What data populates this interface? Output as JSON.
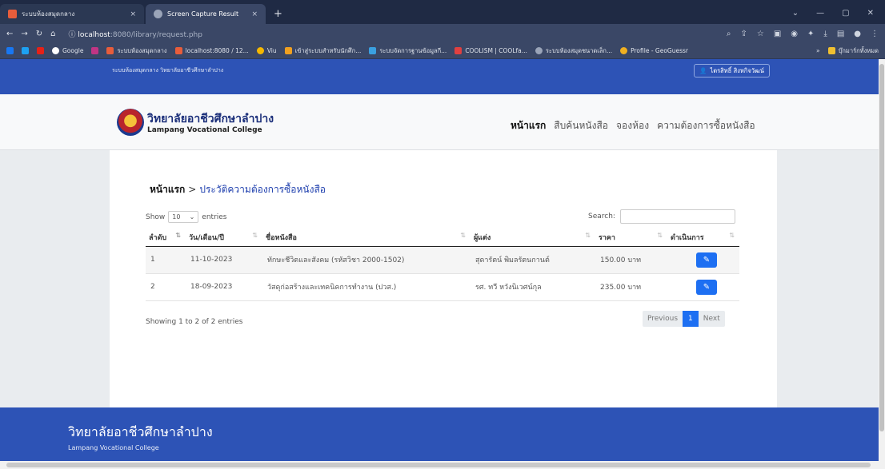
{
  "browser": {
    "tabs": [
      {
        "title": "ระบบห้องสมุดกลาง",
        "close": "×"
      },
      {
        "title": "Screen Capture Result",
        "close": "×"
      }
    ],
    "new_tab": "+",
    "url_host": "localhost",
    "url_path": ":8080/library/request.php",
    "bookmarks": [
      "Google",
      "ระบบห้องสมุดกลาง",
      "localhost:8080 / 12...",
      "Viu",
      "เข้าสู่ระบบสำหรับนักศึก...",
      "ระบบจัดการฐานข้อมูลกี...",
      "COOLISM | COOLfa...",
      "ระบบห้องสมุดชนาดเล็ก...",
      "Profile - GeoGuessr",
      "บุ๊กมาร์กทั้งหมด"
    ]
  },
  "topbar": {
    "site_name": "ระบบห้องสมุดกลาง วิทยาลัยอาชีวศึกษาลำปาง",
    "user_name": "ไตรสิทธิ์ สิงหกิจวัฒน์"
  },
  "navbar": {
    "brand_th": "วิทยาลัยอาชีวศึกษาลำปาง",
    "brand_en": "Lampang Vocational College",
    "menu": [
      "หน้าแรก",
      "สืบค้นหนังสือ",
      "จองห้อง",
      "ความต้องการซื้อหนังสือ"
    ]
  },
  "main": {
    "breadcrumb_home": "หน้าแรก",
    "breadcrumb_sep": ">",
    "breadcrumb_current": "ประวัติความต้องการซื้อหนังสือ",
    "show_label": "Show",
    "show_value": "10",
    "entries_label": "entries",
    "search_label": "Search:",
    "columns": [
      "ลำดับ",
      "วัน/เดือน/ปี",
      "ชื่อหนังสือ",
      "ผู้แต่ง",
      "ราคา",
      "ดำเนินการ"
    ],
    "rows": [
      {
        "no": "1",
        "date": "11-10-2023",
        "title": "ทักษะชีวิตและสังคม (รหัสวิชา 2000-1502)",
        "author": "สุดารัตน์ พิมลรัตนกานต์",
        "price": "150.00 บาท"
      },
      {
        "no": "2",
        "date": "18-09-2023",
        "title": "วัสดุก่อสร้างและเทคนิคการทำงาน (ปวส.)",
        "author": "รศ. ทวี หวังนิเวศน์กุล",
        "price": "235.00 บาท"
      }
    ],
    "info": "Showing 1 to 2 of 2 entries",
    "pagination": {
      "previous": "Previous",
      "page": "1",
      "next": "Next"
    }
  },
  "footer": {
    "title_th": "วิทยาลัยอาชีวศึกษาลำปาง",
    "title_en": "Lampang Vocational College"
  },
  "icons": {
    "edit": "edit-icon",
    "user": "user-icon",
    "sort": "sort-icon"
  }
}
